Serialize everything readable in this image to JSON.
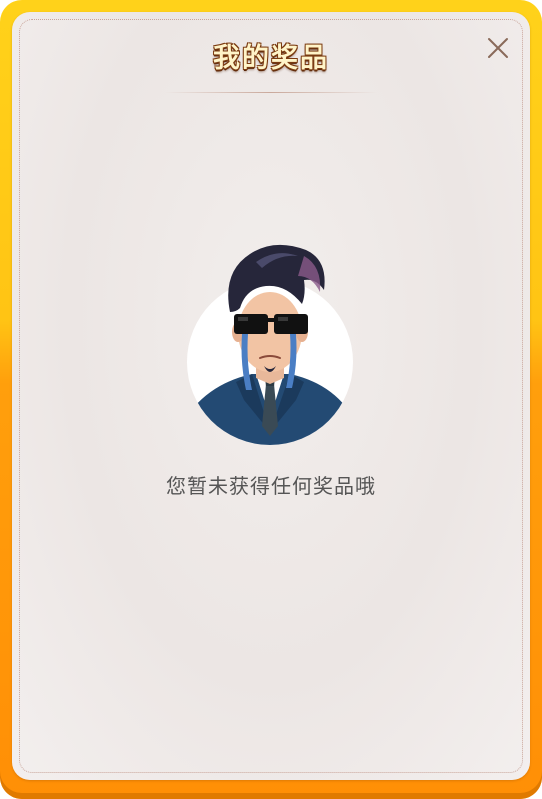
{
  "modal": {
    "title": "我的奖品",
    "close_icon": "close-icon",
    "empty_message": "您暂未获得任何奖品哦",
    "avatar_icon": "crying-man-sunglasses-illustration"
  },
  "colors": {
    "frame_top": "#ffd21a",
    "frame_bottom": "#ff8f06",
    "panel_background": "#ede8e6",
    "title_fill": "#fff4c8",
    "title_stroke": "#7a3a10",
    "message_text": "#555555",
    "close_icon": "#8a6a5a"
  }
}
